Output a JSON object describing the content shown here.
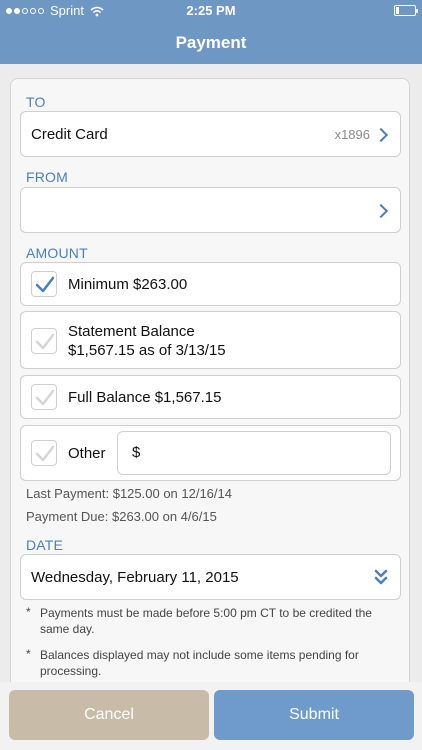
{
  "status_bar": {
    "carrier": "Sprint",
    "time": "2:25 PM",
    "signal_dots_filled": 2,
    "signal_dots_total": 5
  },
  "nav": {
    "title": "Payment"
  },
  "to": {
    "label": "TO",
    "account_name": "Credit Card",
    "account_suffix": "x1896"
  },
  "from": {
    "label": "FROM",
    "value": ""
  },
  "amount": {
    "label": "AMOUNT",
    "options": [
      {
        "line1": "Minimum $263.00",
        "line2": "",
        "checked": true
      },
      {
        "line1": "Statement Balance",
        "line2": "$1,567.15 as of 3/13/15",
        "checked": false
      },
      {
        "line1": "Full Balance $1,567.15",
        "line2": "",
        "checked": false
      },
      {
        "line1": "Other",
        "line2": "",
        "checked": false
      }
    ],
    "other_currency_symbol": "$"
  },
  "payment_info": {
    "last_payment": "Last Payment: $125.00 on 12/16/14",
    "payment_due": "Payment Due: $263.00 on 4/6/15"
  },
  "date": {
    "label": "DATE",
    "value": "Wednesday, February 11, 2015"
  },
  "notes": [
    {
      "marker": "*",
      "text": "Payments must be made before 5:00 pm CT to be credited the same day."
    },
    {
      "marker": "*",
      "text": "Balances displayed may not include some items pending for processing."
    }
  ],
  "buttons": {
    "cancel": "Cancel",
    "submit": "Submit"
  },
  "colors": {
    "nav_bg": "#6f97c4",
    "accent": "#4d7fb7",
    "cancel_bg": "#c8bca9",
    "submit_bg": "#6f9bcc"
  }
}
